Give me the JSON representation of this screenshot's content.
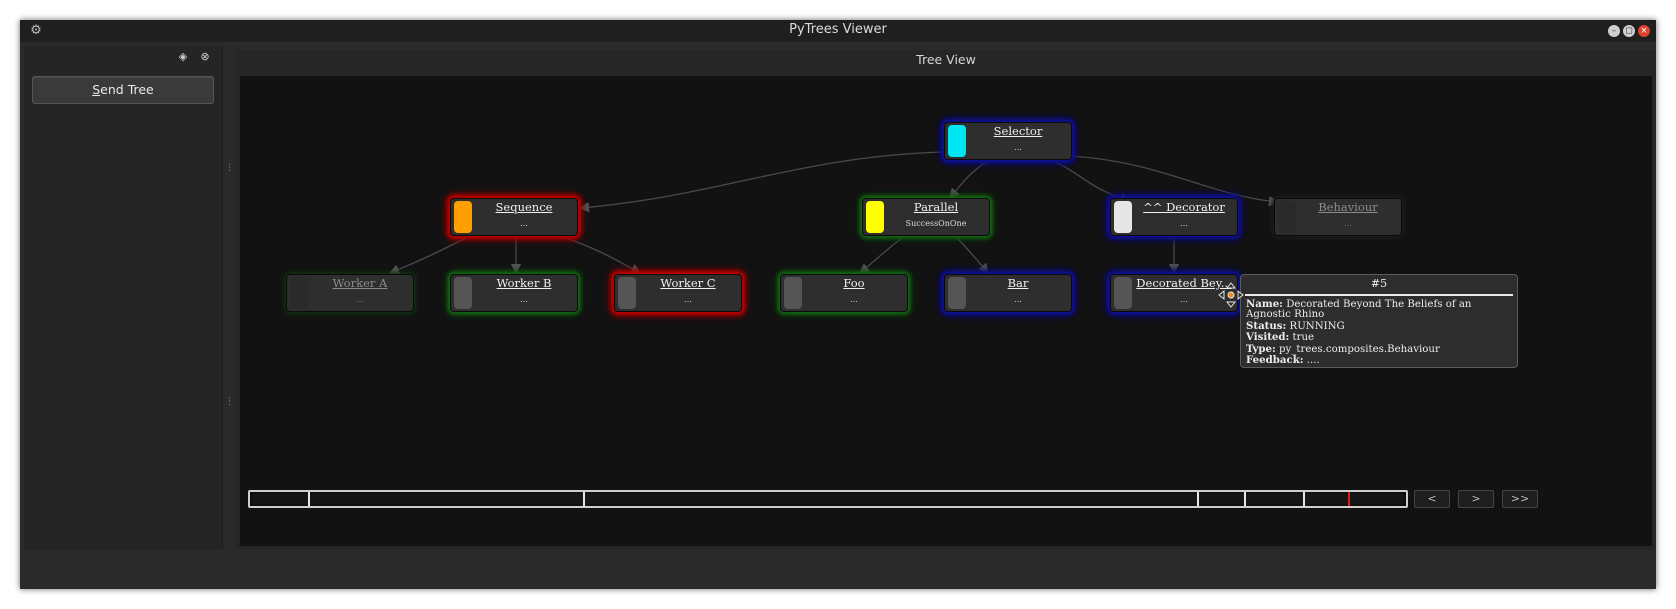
{
  "window": {
    "title": "PyTrees Viewer"
  },
  "dock": {
    "send_button": "Send Tree",
    "send_button_mnemonic": "S",
    "send_button_rest": "end Tree"
  },
  "tree_view": {
    "title": "Tree View"
  },
  "nodes": [
    {
      "id": "selector",
      "name": "Selector",
      "detail": "...",
      "swatch": "#00e6f0"
    },
    {
      "id": "sequence",
      "name": "Sequence",
      "detail": "...",
      "swatch": "#ff9f00"
    },
    {
      "id": "parallel",
      "name": "Parallel",
      "detail": "SuccessOnOne",
      "swatch": "#ffff00"
    },
    {
      "id": "decorator",
      "name": "^^ Decorator",
      "detail": "...",
      "swatch": "#e6e6e6"
    },
    {
      "id": "behaviour",
      "name": "Behaviour",
      "detail": "...",
      "swatch": "#2a2a2a"
    },
    {
      "id": "worker-a",
      "name": "Worker A",
      "detail": "...",
      "swatch": "#2a2a2a"
    },
    {
      "id": "worker-b",
      "name": "Worker B",
      "detail": "...",
      "swatch": "#555555"
    },
    {
      "id": "worker-c",
      "name": "Worker C",
      "detail": "...",
      "swatch": "#555555"
    },
    {
      "id": "foo",
      "name": "Foo",
      "detail": "...",
      "swatch": "#555555"
    },
    {
      "id": "bar",
      "name": "Bar",
      "detail": "...",
      "swatch": "#555555"
    },
    {
      "id": "decorated",
      "name": "Decorated Bey...",
      "detail": "...",
      "swatch": "#555555"
    }
  ],
  "tooltip": {
    "title": "#5",
    "name_label": "Name:",
    "name_value": "Decorated Beyond The Beliefs of an Agnostic Rhino",
    "status_label": "Status:",
    "status_value": "RUNNING",
    "visited_label": "Visited:",
    "visited_value": "true",
    "type_label": "Type:",
    "type_value": "py_trees.composites.Behaviour",
    "feedback_label": "Feedback:",
    "feedback_value": "...."
  },
  "timeline": {
    "buttons": {
      "prev": "<",
      "next": ">",
      "last": ">>"
    },
    "current_color": "#e01b1b"
  },
  "colors": {
    "running_glow": "#c40000",
    "success_glow": "#167016",
    "failure_glow": "#10109a"
  }
}
